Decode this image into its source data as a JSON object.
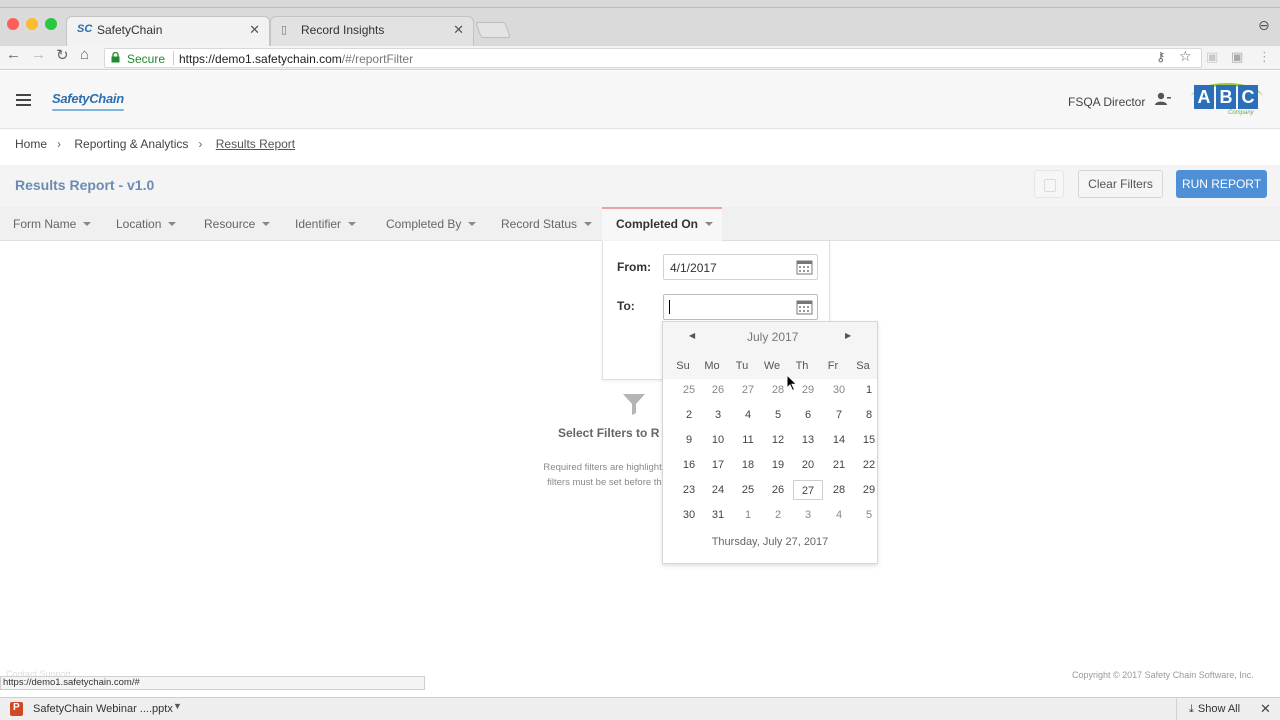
{
  "browser": {
    "tabs": [
      {
        "favicon": "SC",
        "label": "SafetyChain"
      },
      {
        "favicon": "document-icon",
        "label": "Record Insights"
      }
    ],
    "secure_label": "Secure",
    "url_host": "https://demo1.safetychain.com",
    "url_path": "/#/reportFilter",
    "status_url": "https://demo1.safetychain.com/#"
  },
  "header": {
    "logo": "SafetyChain",
    "role": "FSQA Director",
    "company_logo": {
      "letters": [
        "A",
        "B",
        "C"
      ],
      "word": "Company"
    }
  },
  "breadcrumb": [
    "Home",
    "Reporting & Analytics",
    "Results Report"
  ],
  "page": {
    "title": "Results Report - v1.0",
    "clear_filters": "Clear Filters",
    "run_report": "RUN REPORT"
  },
  "filters": [
    "Form Name",
    "Location",
    "Resource",
    "Identifier",
    "Completed By",
    "Record Status",
    "Completed On"
  ],
  "active_filter": "Completed On",
  "date_filter": {
    "from_label": "From:",
    "from_value": "4/1/2017",
    "to_label": "To:",
    "to_value": ""
  },
  "empty_state": {
    "title": "Select Filters to R",
    "line1": "Required filters are highlighte",
    "line2": "filters must be set before the"
  },
  "calendar": {
    "month": "July 2017",
    "days_of_week": [
      "Su",
      "Mo",
      "Tu",
      "We",
      "Th",
      "Fr",
      "Sa"
    ],
    "weeks": [
      [
        "25",
        "26",
        "27",
        "28",
        "29",
        "30",
        "1"
      ],
      [
        "2",
        "3",
        "4",
        "5",
        "6",
        "7",
        "8"
      ],
      [
        "9",
        "10",
        "11",
        "12",
        "13",
        "14",
        "15"
      ],
      [
        "16",
        "17",
        "18",
        "19",
        "20",
        "21",
        "22"
      ],
      [
        "23",
        "24",
        "25",
        "26",
        "27",
        "28",
        "29"
      ],
      [
        "30",
        "31",
        "1",
        "2",
        "3",
        "4",
        "5"
      ]
    ],
    "other_month_cells": [
      [
        0,
        0
      ],
      [
        0,
        1
      ],
      [
        0,
        2
      ],
      [
        0,
        3
      ],
      [
        0,
        4
      ],
      [
        0,
        5
      ],
      [
        5,
        2
      ],
      [
        5,
        3
      ],
      [
        5,
        4
      ],
      [
        5,
        5
      ],
      [
        5,
        6
      ]
    ],
    "today_cell": [
      4,
      4
    ],
    "footer": "Thursday, July 27, 2017"
  },
  "footer": {
    "copyright": "Copyright © 2017 Safety Chain Software, Inc.",
    "download_name": "SafetyChain Webinar ....pptx",
    "show_all": "Show All"
  },
  "colors": {
    "accent": "#4f8fd5",
    "title": "#6b8bb3",
    "secure": "#1e8c2e"
  }
}
